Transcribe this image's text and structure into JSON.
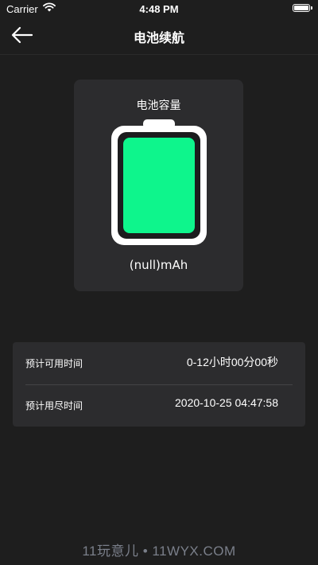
{
  "status_bar": {
    "carrier": "Carrier",
    "time": "4:48 PM"
  },
  "nav": {
    "title": "电池续航",
    "back_icon": "arrow-left-icon"
  },
  "battery_card": {
    "capacity_label": "电池容量",
    "capacity_value": "(null)mAh",
    "fill_color": "#0ef58c",
    "charge_fraction": 1.0
  },
  "info": {
    "rows": [
      {
        "label": "预计可用时间",
        "value": "0-12小时00分00秒"
      },
      {
        "label": "预计用尽时间",
        "value": "2020-10-25 04:47:58"
      }
    ]
  },
  "watermark": "11玩意儿 • 11WYX.COM",
  "colors": {
    "background": "#1e1e1e",
    "card": "#2c2c2e",
    "accent": "#0ef58c"
  }
}
